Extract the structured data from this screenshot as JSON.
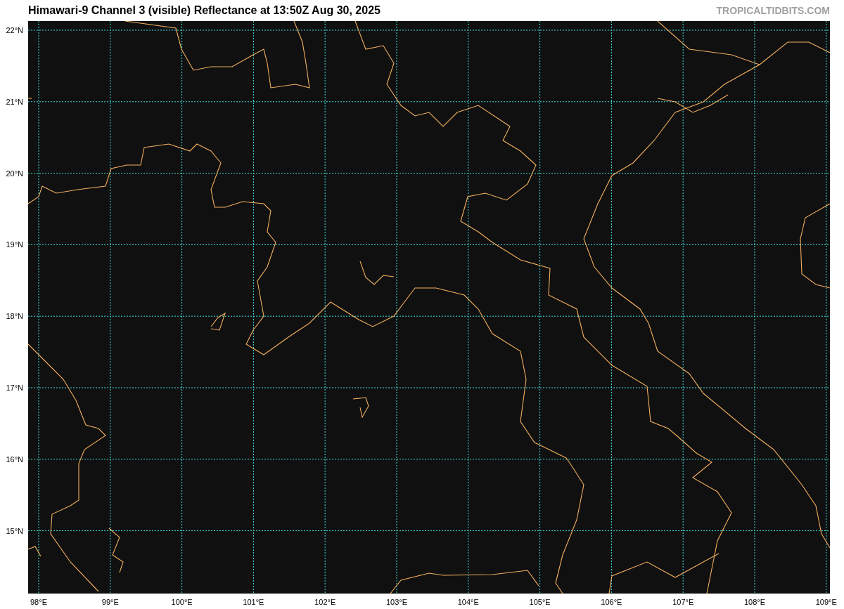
{
  "header": {
    "title": "Himawari-9 Channel 3 (visible) Reflectance at 13:50Z Aug 30, 2025",
    "credit": "TROPICALTIDBITS.COM"
  },
  "map": {
    "lat_labels": [
      "22°N",
      "21°N",
      "20°N",
      "19°N",
      "18°N",
      "17°N",
      "16°N",
      "15°N"
    ],
    "lon_labels": [
      "98°E",
      "99°E",
      "100°E",
      "101°E",
      "102°E",
      "103°E",
      "104°E",
      "105°E",
      "106°E",
      "107°E",
      "108°E",
      "109°E"
    ]
  }
}
